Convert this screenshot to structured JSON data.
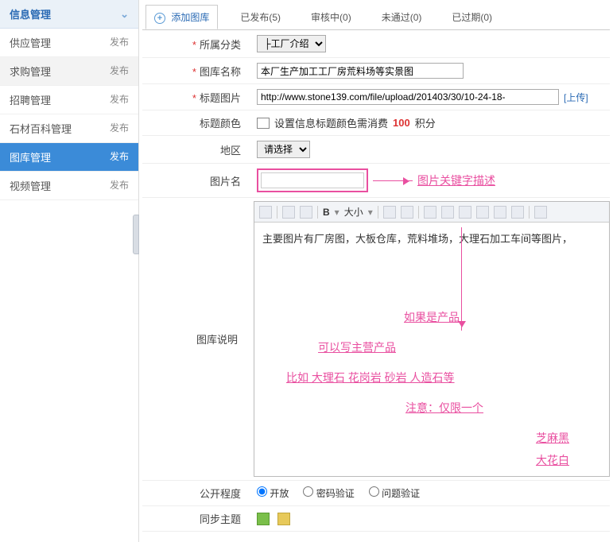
{
  "sidebar": {
    "header": "信息管理",
    "items": [
      {
        "label": "供应管理",
        "action": "发布"
      },
      {
        "label": "求购管理",
        "action": "发布"
      },
      {
        "label": "招聘管理",
        "action": "发布"
      },
      {
        "label": "石材百科管理",
        "action": "发布"
      },
      {
        "label": "图库管理",
        "action": "发布"
      },
      {
        "label": "视频管理",
        "action": "发布"
      }
    ]
  },
  "tabs": {
    "add": "添加图库",
    "published": "已发布(5)",
    "reviewing": "审核中(0)",
    "rejected": "未通过(0)",
    "expired": "已过期(0)"
  },
  "form": {
    "category_label": "所属分类",
    "category_value": "├工厂介绍",
    "name_label": "图库名称",
    "name_value": "本厂生产加工工厂房荒料场等实景图",
    "titleimg_label": "标题图片",
    "titleimg_value": "http://www.stone139.com/file/upload/201403/30/10-24-18-",
    "upload_text": "[上传]",
    "titlecolor_label": "标题颜色",
    "titlecolor_text_a": "设置信息标题颜色需消费",
    "titlecolor_points": "100",
    "titlecolor_text_b": "积分",
    "region_label": "地区",
    "region_value": "请选择",
    "imgname_label": "图片名",
    "imgname_value": "",
    "annotation_keyword": "图片关键字描述",
    "desc_label": "图库说明",
    "desc_text": "主要图片有厂房图，大板仓库，荒料堆场，大理石加工车间等图片，",
    "ann_product": "如果是产品",
    "ann_main": "可以写主营产品",
    "ann_example": "比如  大理石  花岗岩  砂岩  人造石等",
    "ann_note": "注意：仅限一个",
    "ann_p1": "芝麻黑",
    "ann_p2": "大花白",
    "open_label": "公开程度",
    "open_options": [
      "开放",
      "密码验证",
      "问题验证"
    ],
    "sync_label": "同步主题",
    "editor_fontsize": "大小"
  }
}
